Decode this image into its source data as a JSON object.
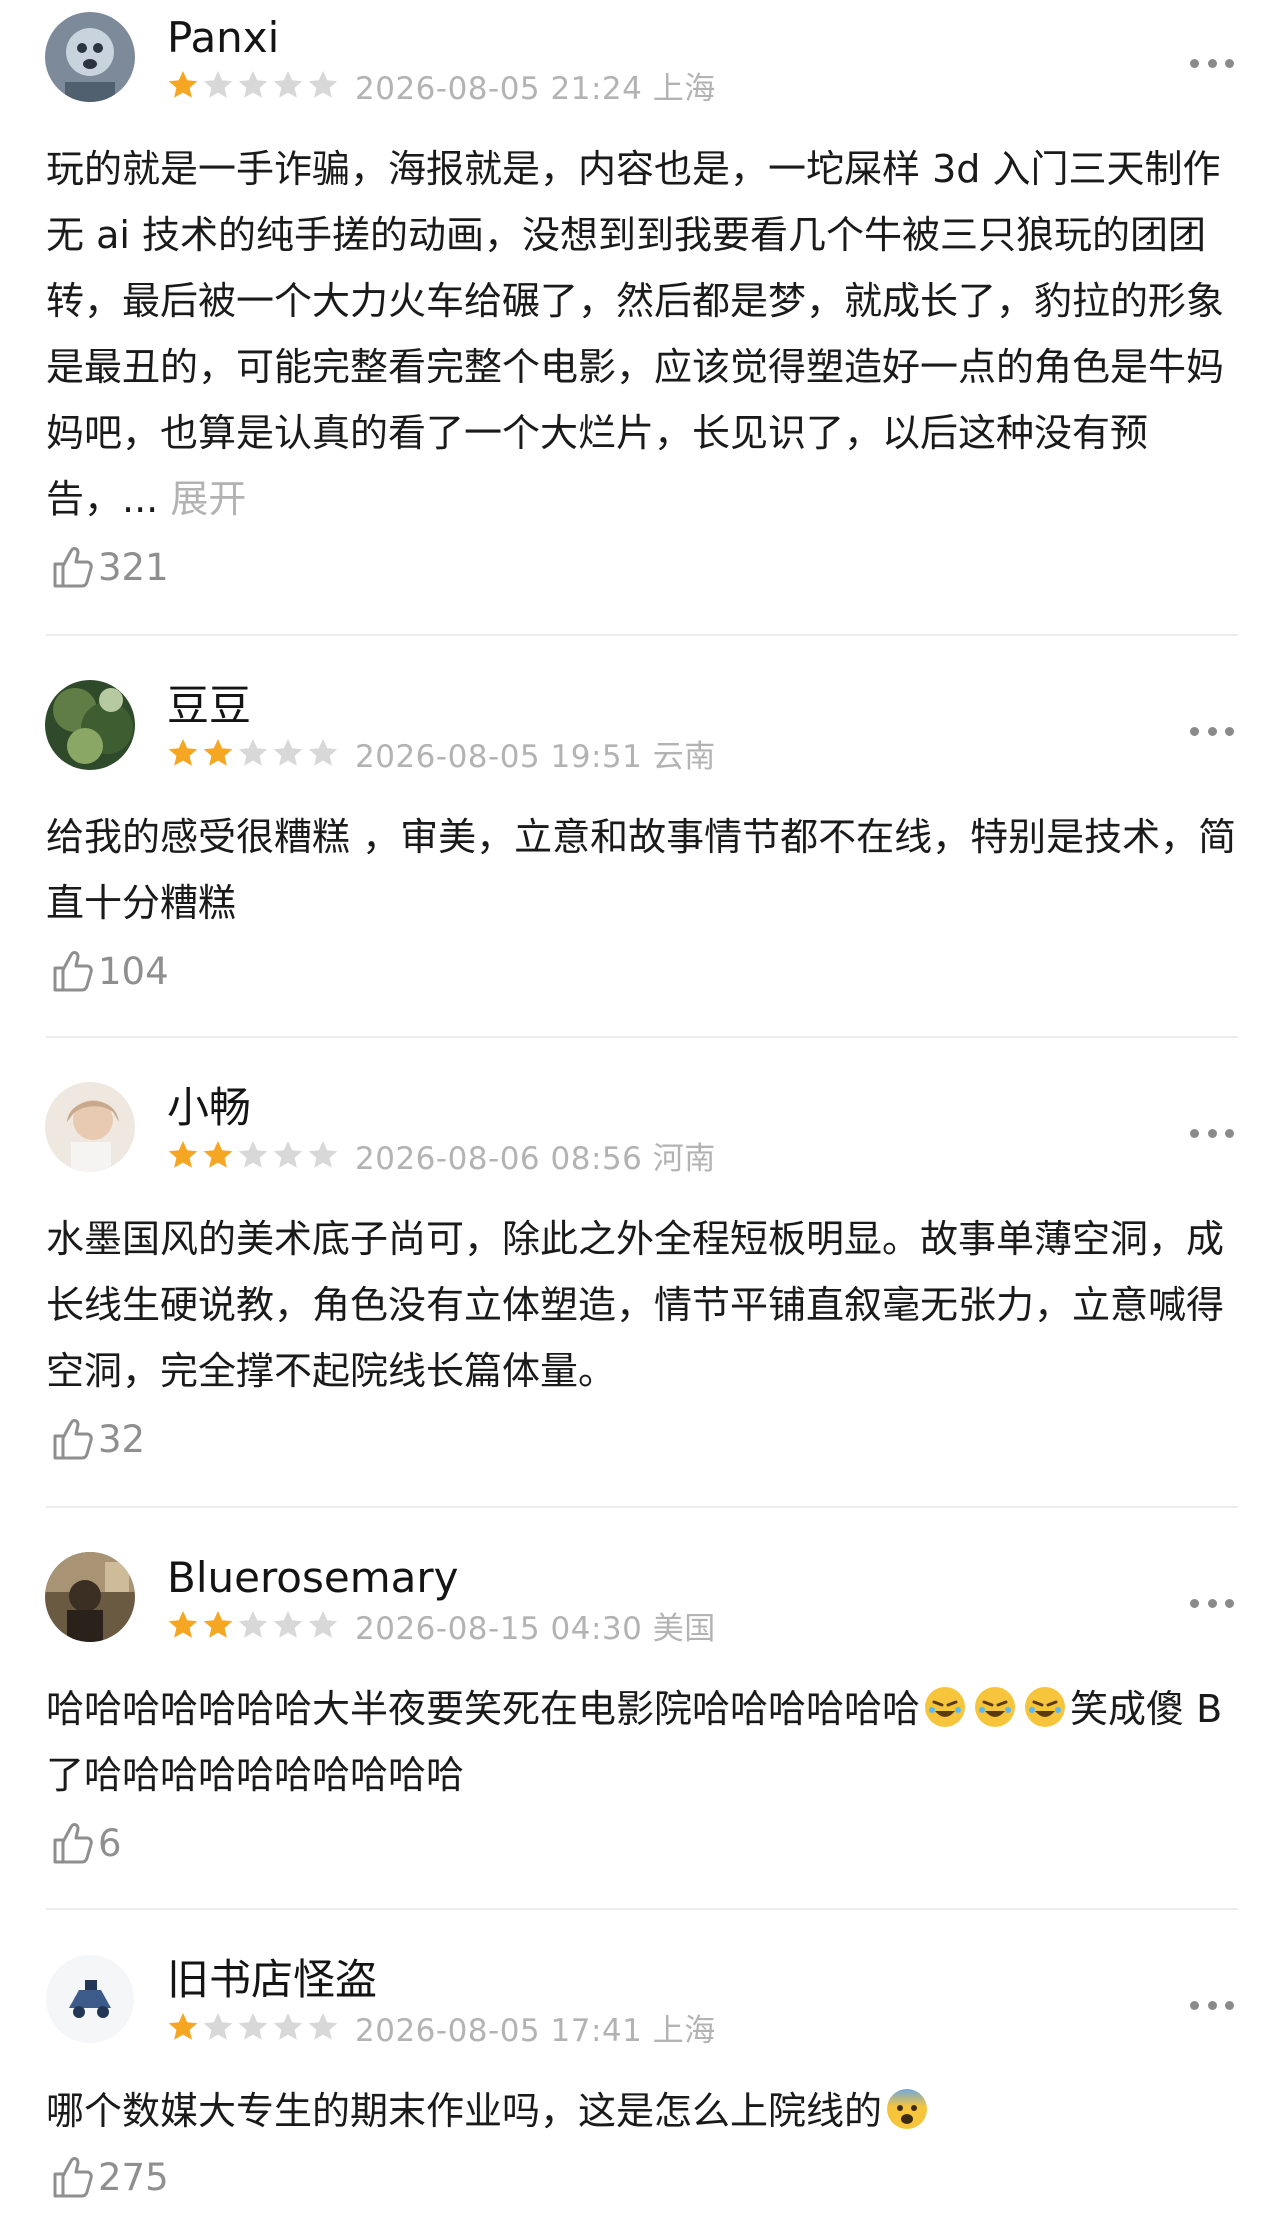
{
  "reviews": [
    {
      "user": "Panxi",
      "rating": 1,
      "date": "2026-08-05 21:24",
      "location": "上海",
      "text": "玩的就是一手诈骗，海报就是，内容也是，一坨屎样 3d 入门三天制作无 ai 技术的纯手搓的动画，没想到到我要看几个牛被三只狼玩的团团转，最后被一个大力火车给碾了，然后都是梦，就成长了，豹拉的形象是最丑的，可能完整看完整个电影，应该觉得塑造好一点的角色是牛妈妈吧，也算是认真的看了一个大烂片，长见识了，以后这种没有预告，...",
      "expand_label": "展开",
      "likes": "321"
    },
    {
      "user": "豆豆",
      "rating": 2,
      "date": "2026-08-05 19:51",
      "location": "云南",
      "text": "给我的感受很糟糕 ，审美，立意和故事情节都不在线，特别是技术，简直十分糟糕",
      "likes": "104"
    },
    {
      "user": "小畅",
      "rating": 2,
      "date": "2026-08-06 08:56",
      "location": "河南",
      "text": "水墨国风的美术底子尚可，除此之外全程短板明显。故事单薄空洞，成长线生硬说教，角色没有立体塑造，情节平铺直叙毫无张力，立意喊得空洞，完全撑不起院线长篇体量。",
      "likes": "32"
    },
    {
      "user": "Bluerosemary",
      "rating": 2,
      "date": "2026-08-15 04:30",
      "location": "美国",
      "text_a": "哈哈哈哈哈哈哈大半夜要笑死在电影院哈哈哈哈哈哈",
      "text_b": "笑成傻 B 了哈哈哈哈哈哈哈哈哈哈",
      "emoji": "rolling-on-floor-laughing",
      "likes": "6"
    },
    {
      "user": "旧书店怪盗",
      "rating": 1,
      "date": "2026-08-05 17:41",
      "location": "上海",
      "text": "哪个数媒大专生的期末作业吗，这是怎么上院线的",
      "emoji": "fearful-face",
      "likes": "275"
    }
  ],
  "colors": {
    "star_on": "#f5a623",
    "star_off": "#d8d8d8",
    "meta_text": "#b3b3b3",
    "divider": "#ececec"
  }
}
